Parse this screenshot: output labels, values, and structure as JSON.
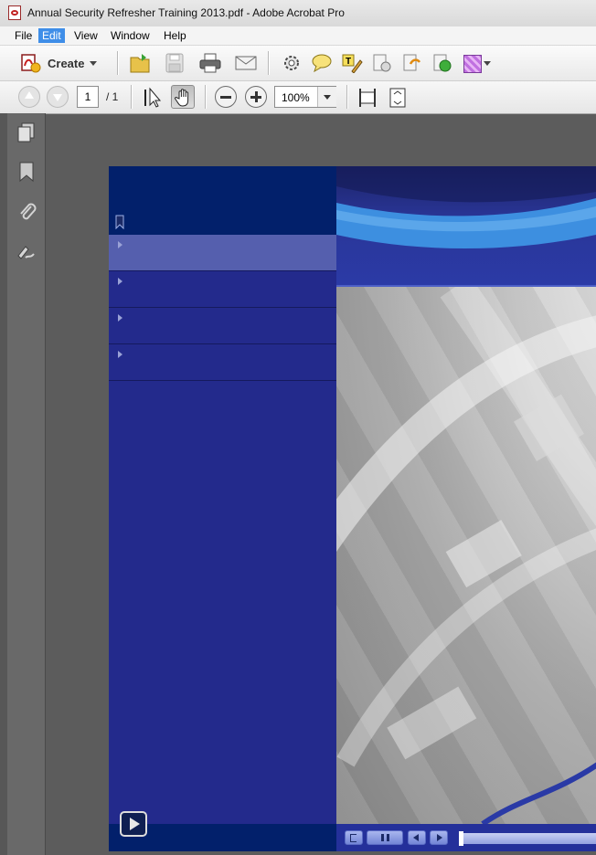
{
  "window": {
    "title": "Annual Security Refresher Training 2013.pdf - Adobe Acrobat Pro"
  },
  "menu": [
    {
      "label": "File",
      "active": false
    },
    {
      "label": "Edit",
      "active": true
    },
    {
      "label": "View",
      "active": false
    },
    {
      "label": "Window",
      "active": false
    },
    {
      "label": "Help",
      "active": false
    }
  ],
  "toolbar": {
    "create_label": "Create",
    "page_current": "1",
    "page_total": "/ 1",
    "zoom": "100%"
  },
  "colors": {
    "accent": "#3f8ee8",
    "doc_blue": "#232a8c",
    "doc_dark_blue": "#02206b",
    "banner_stripe": "#3d8fe0"
  }
}
